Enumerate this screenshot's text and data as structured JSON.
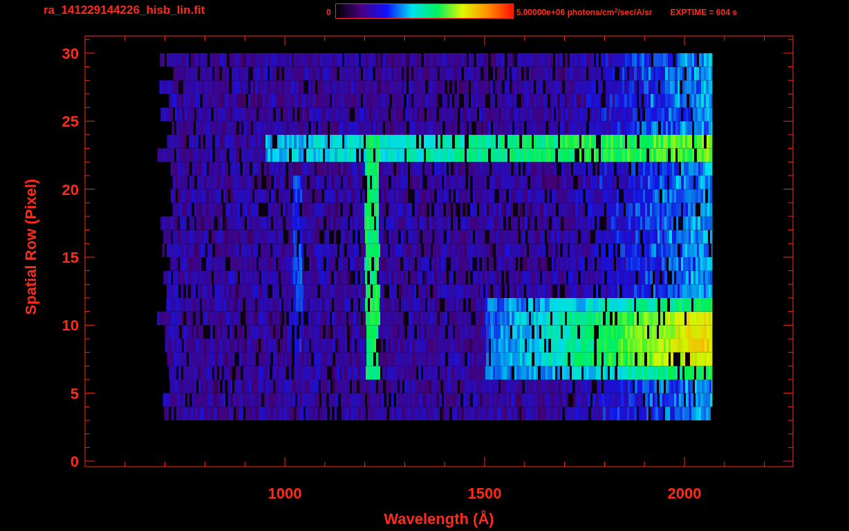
{
  "title": "ra_141229144226_hisb_lin.fit",
  "colorbar": {
    "min_label": "0",
    "max_label": "5.00000e+06 photons/cm$^{2}$/sec/A/sr"
  },
  "exptime": "EXPTIME = 604 s",
  "plot": {
    "xlabel": "Wavelength (Å)",
    "ylabel": "Spatial Row (Pixel)",
    "xtick_labels": [
      "1000",
      "1500",
      "2000"
    ],
    "ytick_labels": [
      "30",
      "25",
      "20",
      "15",
      "10",
      "5",
      "0"
    ]
  }
}
